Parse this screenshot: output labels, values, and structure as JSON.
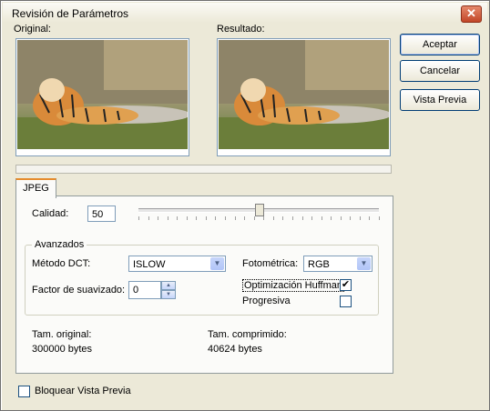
{
  "dialog": {
    "title": "Revisión de Parámetros",
    "close_label": "✕"
  },
  "preview": {
    "original_label": "Original:",
    "result_label": "Resultado:"
  },
  "buttons": {
    "accept": "Aceptar",
    "cancel": "Cancelar",
    "preview": "Vista Previa"
  },
  "tabs": [
    {
      "label": "JPEG"
    }
  ],
  "quality": {
    "label": "Calidad:",
    "value": "50",
    "slider_fraction": 0.5
  },
  "advanced": {
    "title": "Avanzados",
    "dct_label": "Método DCT:",
    "dct_value": "ISLOW",
    "photometric_label": "Fotométrica:",
    "photometric_value": "RGB",
    "smoothing_label": "Factor de suavizado:",
    "smoothing_value": "0",
    "huffman_label": "Optimización Huffman",
    "huffman_checked": true,
    "progressive_label": "Progresiva",
    "progressive_checked": false
  },
  "sizes": {
    "original_label": "Tam. original:",
    "original_value": "300000 bytes",
    "compressed_label": "Tam. comprimido:",
    "compressed_value": "40624 bytes"
  },
  "lock_preview": {
    "label": "Bloquear Vista Previa",
    "checked": false
  },
  "icons": {
    "close": "close-icon",
    "dropdown": "chevron-down-icon",
    "spin_up": "spin-up-icon",
    "spin_down": "spin-down-icon",
    "check": "check-icon"
  }
}
